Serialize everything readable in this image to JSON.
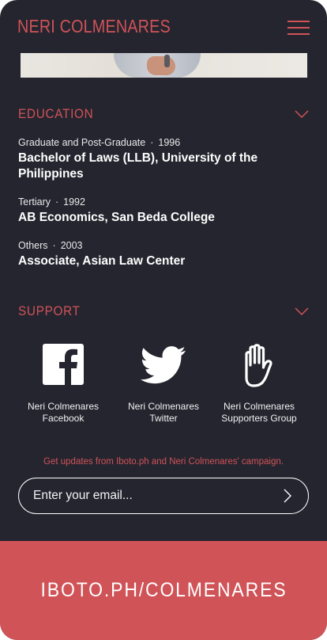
{
  "header": {
    "brand": "NERI COLMENARES"
  },
  "education": {
    "title": "EDUCATION",
    "items": [
      {
        "level": "Graduate and Post-Graduate",
        "year": "1996",
        "degree": "Bachelor of Laws (LLB), University of the Philippines"
      },
      {
        "level": "Tertiary",
        "year": "1992",
        "degree": "AB Economics, San Beda College"
      },
      {
        "level": "Others",
        "year": "2003",
        "degree": "Associate, Asian Law Center"
      }
    ]
  },
  "support": {
    "title": "SUPPORT",
    "items": [
      {
        "icon": "facebook-icon",
        "line1": "Neri Colmenares",
        "line2": "Facebook"
      },
      {
        "icon": "twitter-icon",
        "line1": "Neri Colmenares",
        "line2": "Twitter"
      },
      {
        "icon": "hand-icon",
        "line1": "Neri Colmenares",
        "line2": "Supporters Group"
      }
    ]
  },
  "newsletter": {
    "note": "Get updates from Iboto.ph and Neri Colmenares' campaign.",
    "placeholder": "Enter your email...",
    "value": ""
  },
  "footer": {
    "url": "IBOTO.PH/COLMENARES"
  },
  "colors": {
    "background": "#25252f",
    "accent": "#d05358",
    "text": "#ffffff"
  }
}
